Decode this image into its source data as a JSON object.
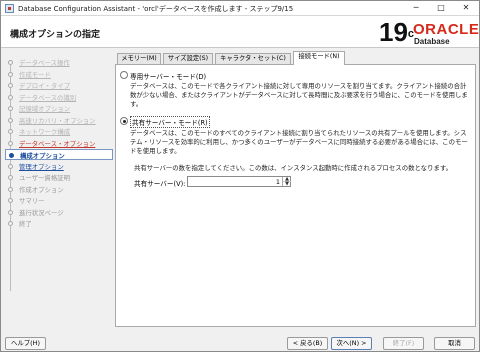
{
  "window": {
    "title": "Database Configuration Assistant - 'orcl'データベースを作成します - ステップ9/15",
    "minimize": "─",
    "maximize": "□",
    "close": "✕"
  },
  "header": {
    "page_title": "構成オプションの指定",
    "logo_version": "19",
    "logo_version_sup": "c",
    "logo_brand": "ORACLE",
    "logo_product": "Database"
  },
  "sidebar": {
    "steps": [
      {
        "label": "データベース操作",
        "state": "done"
      },
      {
        "label": "作成モード",
        "state": "done"
      },
      {
        "label": "デプロイ・タイプ",
        "state": "done"
      },
      {
        "label": "データベースの識別",
        "state": "done"
      },
      {
        "label": "記憶域オプション",
        "state": "done"
      },
      {
        "label": "高速リカバリ・オプション",
        "state": "done"
      },
      {
        "label": "ネットワーク構成",
        "state": "done"
      },
      {
        "label": "データベース・オプション",
        "state": "link-red"
      },
      {
        "label": "構成オプション",
        "state": "current"
      },
      {
        "label": "管理オプション",
        "state": "link-blue"
      },
      {
        "label": "ユーザー資格証明",
        "state": "todo"
      },
      {
        "label": "作成オプション",
        "state": "todo"
      },
      {
        "label": "サマリー",
        "state": "todo"
      },
      {
        "label": "進行状況ページ",
        "state": "todo"
      },
      {
        "label": "終了",
        "state": "todo"
      }
    ]
  },
  "tabs": [
    {
      "label": "メモリー(M)",
      "active": false
    },
    {
      "label": "サイズ設定(S)",
      "active": false
    },
    {
      "label": "キャラクタ・セット(C)",
      "active": false
    },
    {
      "label": "接続モード(N)",
      "active": true
    }
  ],
  "connection_mode": {
    "dedicated_label": "専用サーバー・モード(D)",
    "dedicated_checked": false,
    "dedicated_desc": "データベースは、このモードで各クライアント接続に対して専用のリソースを割り当てます。クライアント接続の合計数が少ない場合、またはクライアントがデータベースに対して長時間に及ぶ要求を行う場合に、このモードを使用します。",
    "shared_label": "共有サーバー・モード(R)",
    "shared_checked": true,
    "shared_desc": "データベースは、このモードのすべてのクライアント接続に割り当てられたリソースの共有プールを使用します。システム・リソースを効率的に利用し、かつ多くのユーザーがデータベースに同時接続する必要がある場合には、このモードを使用します。",
    "servers_hint": "共有サーバーの数を指定してください。この数は、インスタンス起動時に作成されるプロセスの数となります。",
    "servers_label": "共有サーバー(V):",
    "servers_value": "1"
  },
  "footer": {
    "help": "ヘルプ(H)",
    "back": "< 戻る(B)",
    "next": "次へ(N) >",
    "finish": "終了(F)",
    "cancel": "取消"
  }
}
